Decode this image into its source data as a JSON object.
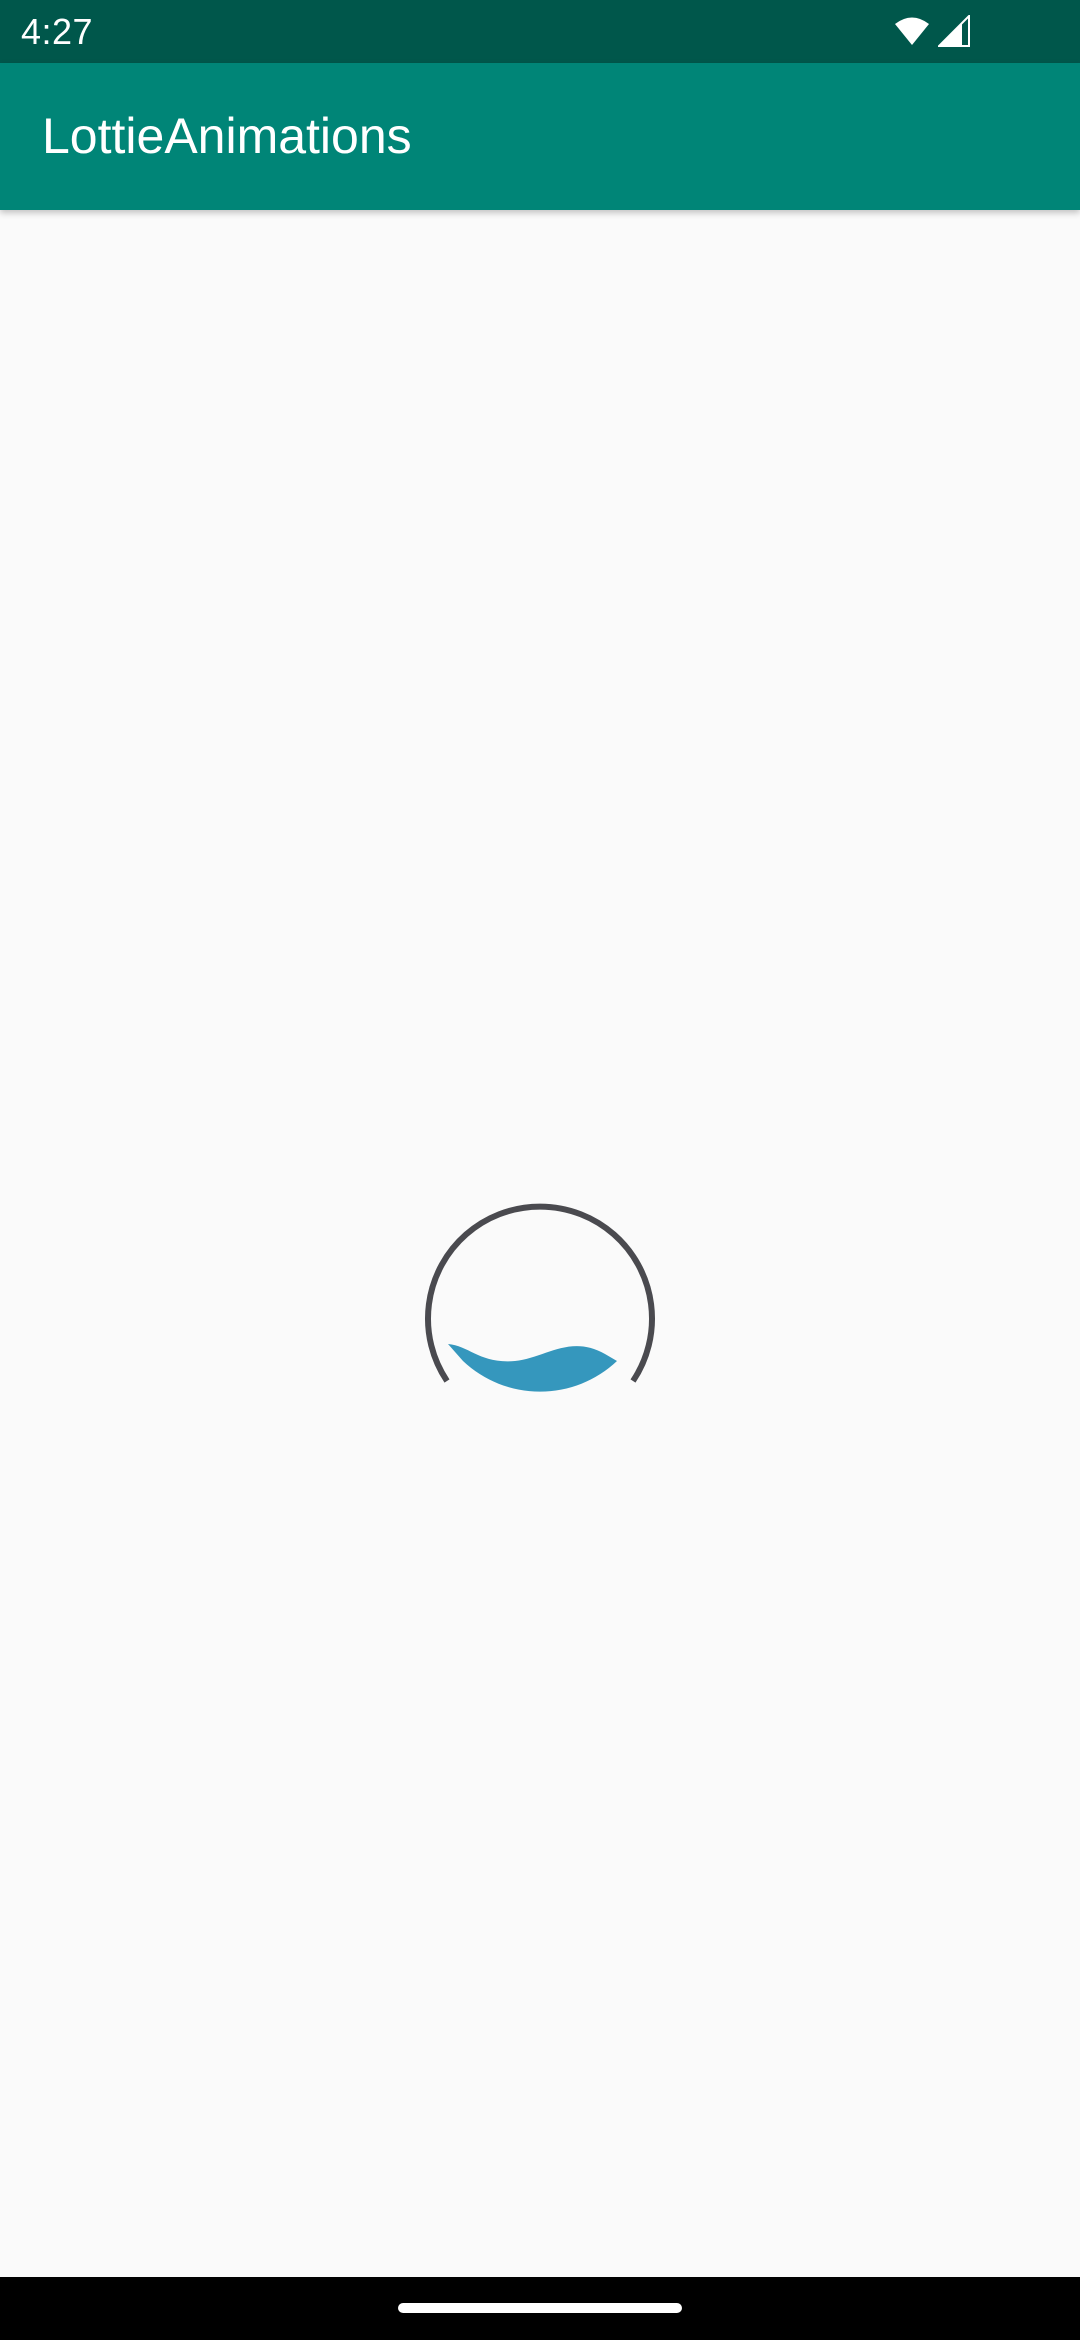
{
  "status_bar": {
    "time": "4:27",
    "icons": [
      "wifi-icon",
      "cellular-signal-icon"
    ],
    "background": "#00574b"
  },
  "app_bar": {
    "title": "LottieAnimations",
    "background": "#008577"
  },
  "content": {
    "animation": {
      "name": "loading-water-circle-animation",
      "ring_color": "#4a4a4f",
      "water_color": "#3597bd"
    },
    "background": "#fafafa"
  },
  "nav_bar": {
    "background": "#000000",
    "handle": "gesture-home-handle"
  }
}
